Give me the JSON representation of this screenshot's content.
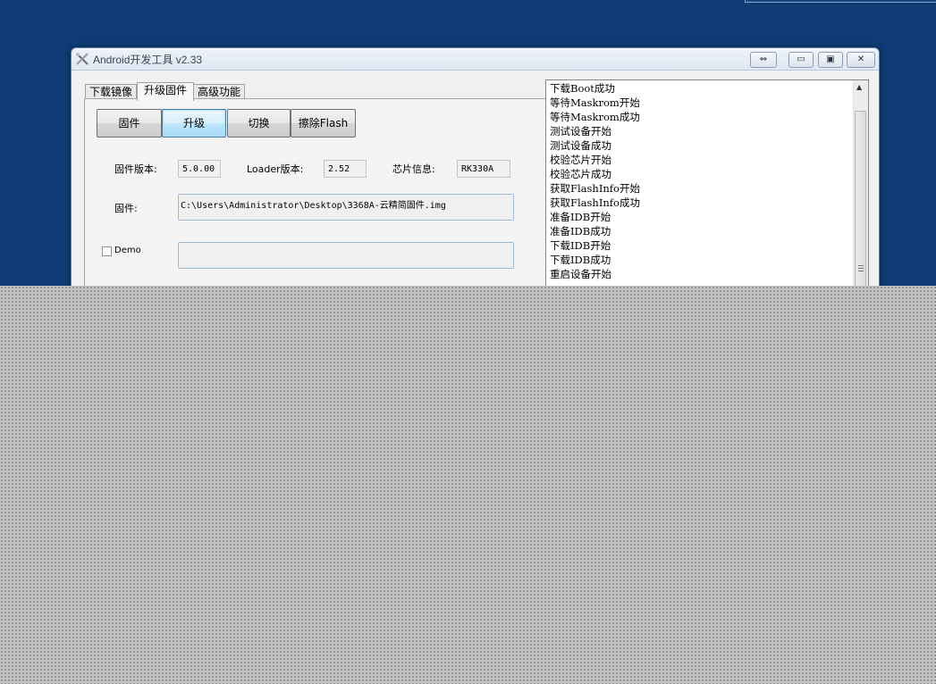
{
  "window": {
    "title": "Android开发工具 v2.33",
    "controls": {
      "swap_icon": "⇔",
      "minimize_icon": "▭",
      "maximize_icon": "▣",
      "close_icon": "✕"
    }
  },
  "tabs": [
    {
      "label": "下载镜像",
      "active": false
    },
    {
      "label": "升级固件",
      "active": true
    },
    {
      "label": "高级功能",
      "active": false
    }
  ],
  "buttons": {
    "firmware": "固件",
    "upgrade": "升级",
    "switch": "切换",
    "erase_flash": "擦除Flash"
  },
  "info": {
    "fw_version_label": "固件版本:",
    "fw_version_value": "5.0.00",
    "loader_version_label": "Loader版本:",
    "loader_version_value": "2.52",
    "chip_info_label": "芯片信息:",
    "chip_info_value": "RK330A"
  },
  "firmware_path": {
    "label": "固件:",
    "value": "C:\\Users\\Administrator\\Desktop\\3368A-云精简固件.img"
  },
  "demo": {
    "label": "Demo",
    "checked": false,
    "value": ""
  },
  "log": {
    "lines": [
      "下载Boot成功",
      "等待Maskrom开始",
      "等待Maskrom成功",
      "测试设备开始",
      "测试设备成功",
      "校验芯片开始",
      "校验芯片成功",
      "获取FlashInfo开始",
      "获取FlashInfo成功",
      "准备IDB开始",
      "准备IDB成功",
      "下载IDB开始",
      "下载IDB成功",
      "重启设备开始"
    ]
  },
  "colors": {
    "desktop": "#0e3b73",
    "window_bg": "#f0f0f0",
    "focused_button": "#3c7fb1"
  }
}
